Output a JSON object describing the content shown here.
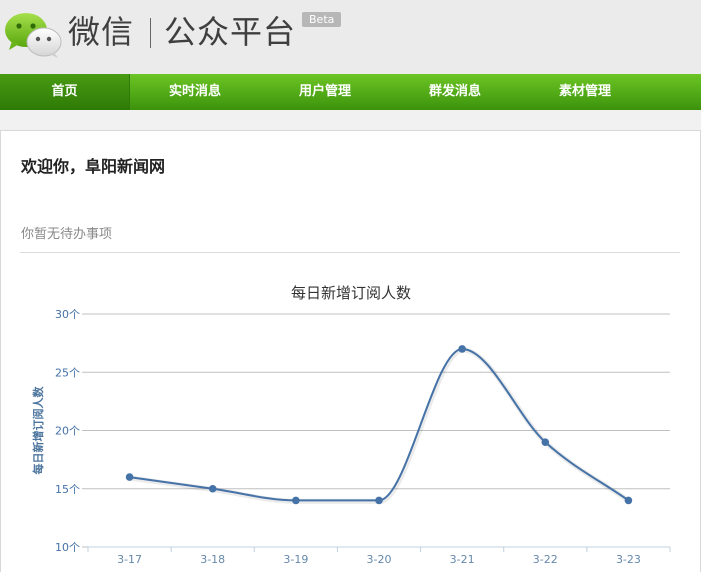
{
  "header": {
    "logo_icon": "wechat-logo-icon",
    "title_wechat": "微信",
    "title_platform": "公众平台",
    "beta": "Beta"
  },
  "nav": {
    "items": [
      {
        "label": "首页",
        "active": true
      },
      {
        "label": "实时消息",
        "active": false
      },
      {
        "label": "用户管理",
        "active": false
      },
      {
        "label": "群发消息",
        "active": false
      },
      {
        "label": "素材管理",
        "active": false
      }
    ]
  },
  "main": {
    "welcome": "欢迎你，阜阳新闻网",
    "todo": "你暂无待办事项"
  },
  "chart_data": {
    "type": "line",
    "title": "每日新增订阅人数",
    "ylabel": "每日新增订阅人数",
    "xlabel": "",
    "categories": [
      "3-17",
      "3-18",
      "3-19",
      "3-20",
      "3-21",
      "3-22",
      "3-23"
    ],
    "series": [
      {
        "values": [
          16,
          15,
          14,
          14,
          27,
          19,
          14
        ]
      }
    ],
    "ylim": [
      10,
      30
    ],
    "yticks": [
      10,
      15,
      20,
      25,
      30
    ],
    "ytick_suffix": "个",
    "grid": true,
    "colors": {
      "line": "#4572a7",
      "grid": "#c0c0c0",
      "axis": "#c0d0e0",
      "tick_text": "#4572a7"
    }
  }
}
